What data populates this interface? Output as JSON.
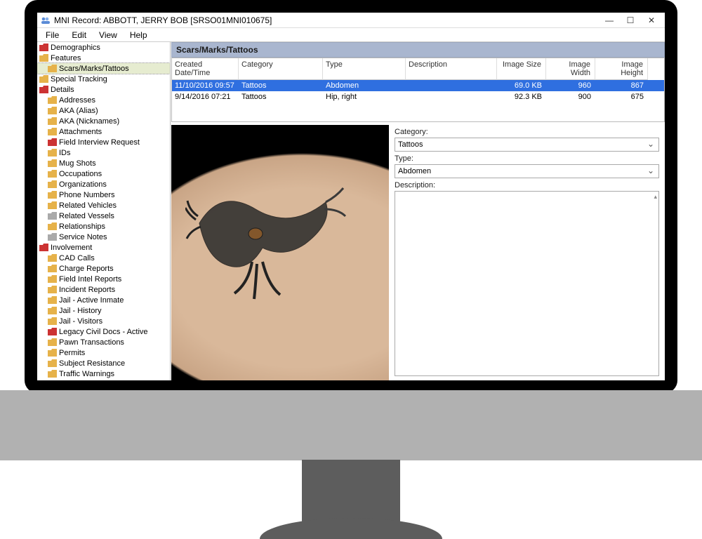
{
  "window": {
    "title": "MNI Record: ABBOTT, JERRY BOB  [SRSO01MNI010675]"
  },
  "menu": {
    "file": "File",
    "edit": "Edit",
    "view": "View",
    "help": "Help"
  },
  "sidebar": {
    "items": [
      {
        "label": "Demographics",
        "icon": "folder-red",
        "level": 0
      },
      {
        "label": "Features",
        "icon": "folder",
        "level": 0
      },
      {
        "label": "Scars/Marks/Tattoos",
        "icon": "folder",
        "level": 1,
        "selected": true
      },
      {
        "label": "Special Tracking",
        "icon": "folder",
        "level": 0
      },
      {
        "label": "Details",
        "icon": "folder-red",
        "level": 0
      },
      {
        "label": "Addresses",
        "icon": "folder",
        "level": 1
      },
      {
        "label": "AKA (Alias)",
        "icon": "folder",
        "level": 1
      },
      {
        "label": "AKA (Nicknames)",
        "icon": "folder",
        "level": 1
      },
      {
        "label": "Attachments",
        "icon": "folder",
        "level": 1
      },
      {
        "label": "Field Interview Request",
        "icon": "folder-red",
        "level": 1
      },
      {
        "label": "IDs",
        "icon": "folder",
        "level": 1
      },
      {
        "label": "Mug Shots",
        "icon": "folder",
        "level": 1
      },
      {
        "label": "Occupations",
        "icon": "folder",
        "level": 1
      },
      {
        "label": "Organizations",
        "icon": "folder",
        "level": 1
      },
      {
        "label": "Phone Numbers",
        "icon": "folder",
        "level": 1
      },
      {
        "label": "Related Vehicles",
        "icon": "folder",
        "level": 1
      },
      {
        "label": "Related Vessels",
        "icon": "folder-grey",
        "level": 1
      },
      {
        "label": "Relationships",
        "icon": "folder",
        "level": 1
      },
      {
        "label": "Service Notes",
        "icon": "folder-grey",
        "level": 1
      },
      {
        "label": "Involvement",
        "icon": "folder-red",
        "level": 0
      },
      {
        "label": "CAD Calls",
        "icon": "folder",
        "level": 1
      },
      {
        "label": "Charge Reports",
        "icon": "folder",
        "level": 1
      },
      {
        "label": "Field Intel Reports",
        "icon": "folder",
        "level": 1
      },
      {
        "label": "Incident Reports",
        "icon": "folder",
        "level": 1
      },
      {
        "label": "Jail - Active Inmate",
        "icon": "folder",
        "level": 1
      },
      {
        "label": "Jail - History",
        "icon": "folder",
        "level": 1
      },
      {
        "label": "Jail - Visitors",
        "icon": "folder",
        "level": 1
      },
      {
        "label": "Legacy Civil Docs - Active",
        "icon": "folder-red",
        "level": 1
      },
      {
        "label": "Pawn Transactions",
        "icon": "folder",
        "level": 1
      },
      {
        "label": "Permits",
        "icon": "folder",
        "level": 1
      },
      {
        "label": "Subject Resistance",
        "icon": "folder",
        "level": 1
      },
      {
        "label": "Traffic Warnings",
        "icon": "folder",
        "level": 1
      }
    ]
  },
  "panel": {
    "title": "Scars/Marks/Tattoos"
  },
  "grid": {
    "columns": {
      "created": "Created Date/Time",
      "category": "Category",
      "type": "Type",
      "description": "Description",
      "size": "Image Size",
      "width": "Image Width",
      "height": "Image Height"
    },
    "rows": [
      {
        "created": "11/10/2016 09:57",
        "category": "Tattoos",
        "type": "Abdomen",
        "description": "",
        "size": "69.0 KB",
        "width": "960",
        "height": "867",
        "selected": true
      },
      {
        "created": "9/14/2016 07:21",
        "category": "Tattoos",
        "type": "Hip, right",
        "description": "",
        "size": "92.3 KB",
        "width": "900",
        "height": "675"
      }
    ]
  },
  "form": {
    "category_label": "Category:",
    "category_value": "Tattoos",
    "type_label": "Type:",
    "type_value": "Abdomen",
    "description_label": "Description:",
    "description_value": ""
  }
}
